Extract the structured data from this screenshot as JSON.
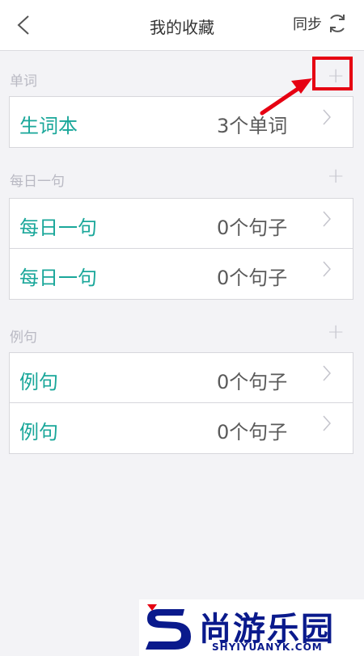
{
  "nav": {
    "title": "我的收藏",
    "sync_label": "同步"
  },
  "sections": [
    {
      "label": "单词",
      "add_symbol": "+",
      "items": [
        {
          "title": "生词本",
          "count": "3个单词"
        }
      ]
    },
    {
      "label": "每日一句",
      "add_symbol": "+",
      "items": [
        {
          "title": "每日一句",
          "count": "0个句子"
        },
        {
          "title": "每日一句",
          "count": "0个句子"
        }
      ]
    },
    {
      "label": "例句",
      "add_symbol": "+",
      "items": [
        {
          "title": "例句",
          "count": "0个句子"
        },
        {
          "title": "例句",
          "count": "0个句子"
        }
      ]
    }
  ],
  "watermark": {
    "text_cn": "尚游乐园",
    "text_en": "SHYIYUANYK.COM"
  },
  "colors": {
    "accent": "#1aa79a",
    "highlight": "#e60012",
    "logo": "#0a1a8c"
  }
}
